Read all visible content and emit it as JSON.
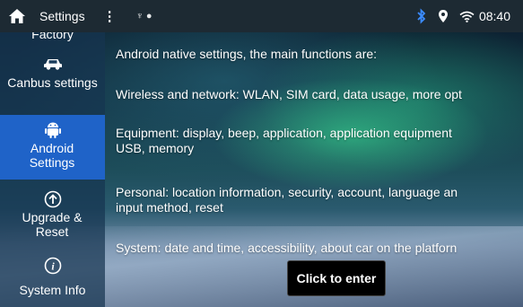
{
  "statusbar": {
    "title": "Settings",
    "menu_glyph": "⋮",
    "small_icons": "♆ ●",
    "time": "08:40",
    "icons": [
      "home-icon",
      "bluetooth-icon",
      "location-icon",
      "wifi-icon"
    ]
  },
  "sidebar": {
    "items": [
      {
        "label": "Factory",
        "icon": "factory-icon",
        "active": false
      },
      {
        "label": "Canbus settings",
        "icon": "car-icon",
        "active": false
      },
      {
        "label": "Android Settings",
        "icon": "android-icon",
        "active": true
      },
      {
        "label": "Upgrade & Reset",
        "icon": "upgrade-icon",
        "active": false
      },
      {
        "label": "System Info",
        "icon": "info-icon",
        "active": false
      }
    ]
  },
  "main": {
    "lines": [
      "Android native settings, the main functions are:",
      "Wireless and network: WLAN, SIM card, data usage, more opt",
      "Equipment: display, beep, application, application equipment",
      "USB, memory",
      "Personal: location information, security, account, language an",
      "input method, reset",
      "System: date and time, accessibility, about car on the platforn"
    ],
    "enter_button": "Click to enter"
  },
  "colors": {
    "statusbar_bg": "#1d2a33",
    "active_item": "#1f63c8",
    "bluetooth": "#3b8cff"
  }
}
